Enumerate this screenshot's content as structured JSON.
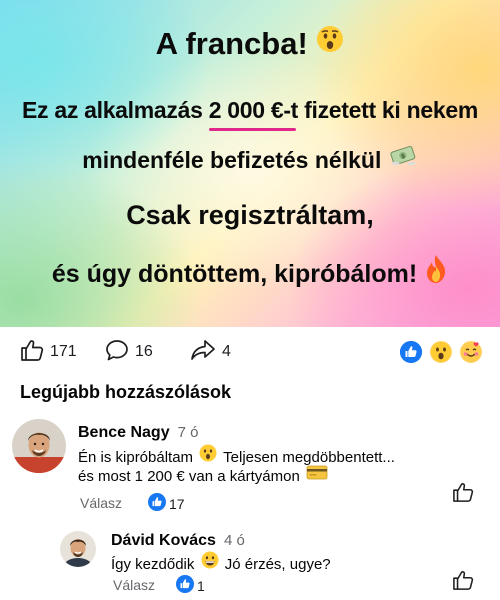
{
  "hero": {
    "line1_text": "A francba!",
    "line2_before": "Ez az alkalmazás ",
    "line2_amount": "2 000 €-t",
    "line2_after": " fizetett ki nekem",
    "line3_text": "mindenféle befizetés nélkül",
    "line4_text": "Csak regisztráltam,",
    "line5_text": "és úgy döntöttem, kipróbálom!"
  },
  "stats": {
    "likes": "171",
    "comments": "16",
    "shares": "4"
  },
  "comments_section": {
    "title": "Legújabb hozzászólások"
  },
  "comments": [
    {
      "name": "Bence Nagy",
      "time": "7 ó",
      "text_line1_a": "Én is kipróbáltam",
      "text_line1_b": "Teljesen megdöbbentett...",
      "text_line2": "és most 1 200 € van a kártyámon",
      "reply_label": "Válasz",
      "likes": "17"
    },
    {
      "name": "Dávid Kovács",
      "time": "4 ó",
      "text_a": "Így kezdődik",
      "text_b": "Jó érzés, ugye?",
      "reply_label": "Válasz",
      "likes": "1"
    }
  ],
  "colors": {
    "facebook_blue": "#1877f2",
    "secondary_text": "#65676b",
    "underline_pink": "#e0288a"
  },
  "icons": [
    "shocked-face-emoji",
    "money-with-wings-emoji",
    "fire-emoji",
    "thumbs-up-icon",
    "comment-icon",
    "share-icon",
    "like-reaction-icon",
    "wow-reaction-icon",
    "love-face-reaction-icon",
    "credit-card-emoji",
    "grinning-face-emoji"
  ]
}
